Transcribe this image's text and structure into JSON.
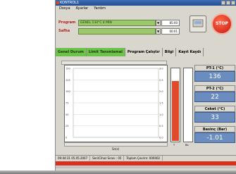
{
  "window": {
    "title": "KONTROL1"
  },
  "menu": [
    "Dosya",
    "Ayarlar",
    "Yardım"
  ],
  "program": {
    "label": "Program",
    "value": "GENEL 134°C 4 MIN",
    "dd": "▼",
    "readout": "85:00"
  },
  "safha": {
    "label": "Safha",
    "value": "",
    "dd": "▼",
    "readout": "00:01"
  },
  "stop_label": "STOP",
  "tabs": [
    "Genel Durum",
    "Limit Tanımlamal",
    "Program Çalıştır",
    "Bilgi",
    "Kayıt Kaydı"
  ],
  "chart_data": {
    "type": "line",
    "xlabel": "Sn(s)",
    "y_ticks": [
      "150",
      "125",
      "100",
      "75",
      "50",
      "25",
      "0"
    ],
    "y2_ticks": [
      "3.0",
      "2.5",
      "2.0",
      "1.5",
      "1.0",
      "0.5",
      "0.0"
    ],
    "x_ticks": [
      ""
    ],
    "series": []
  },
  "gauges": {
    "left_level": 0.83,
    "right_level": 0.0,
    "left_label": "T",
    "right_label": "Ba"
  },
  "readouts": [
    {
      "title": "PT-1 (°C)",
      "value": "136"
    },
    {
      "title": "PT-2 (°C)",
      "value": "22"
    },
    {
      "title": "Ceket (°C)",
      "value": "33"
    },
    {
      "title": "Basinç (Bar)",
      "value": "-1.01"
    }
  ],
  "status": [
    "09:44:31   05.05.2007",
    "Seri/Cihaz Sırası : 05",
    "Toplam Çevrim: 000002"
  ],
  "colors": {
    "accent_green": "#6cc24a",
    "readout_blue": "#6b8cbf",
    "alarm_red": "#d8301c"
  }
}
